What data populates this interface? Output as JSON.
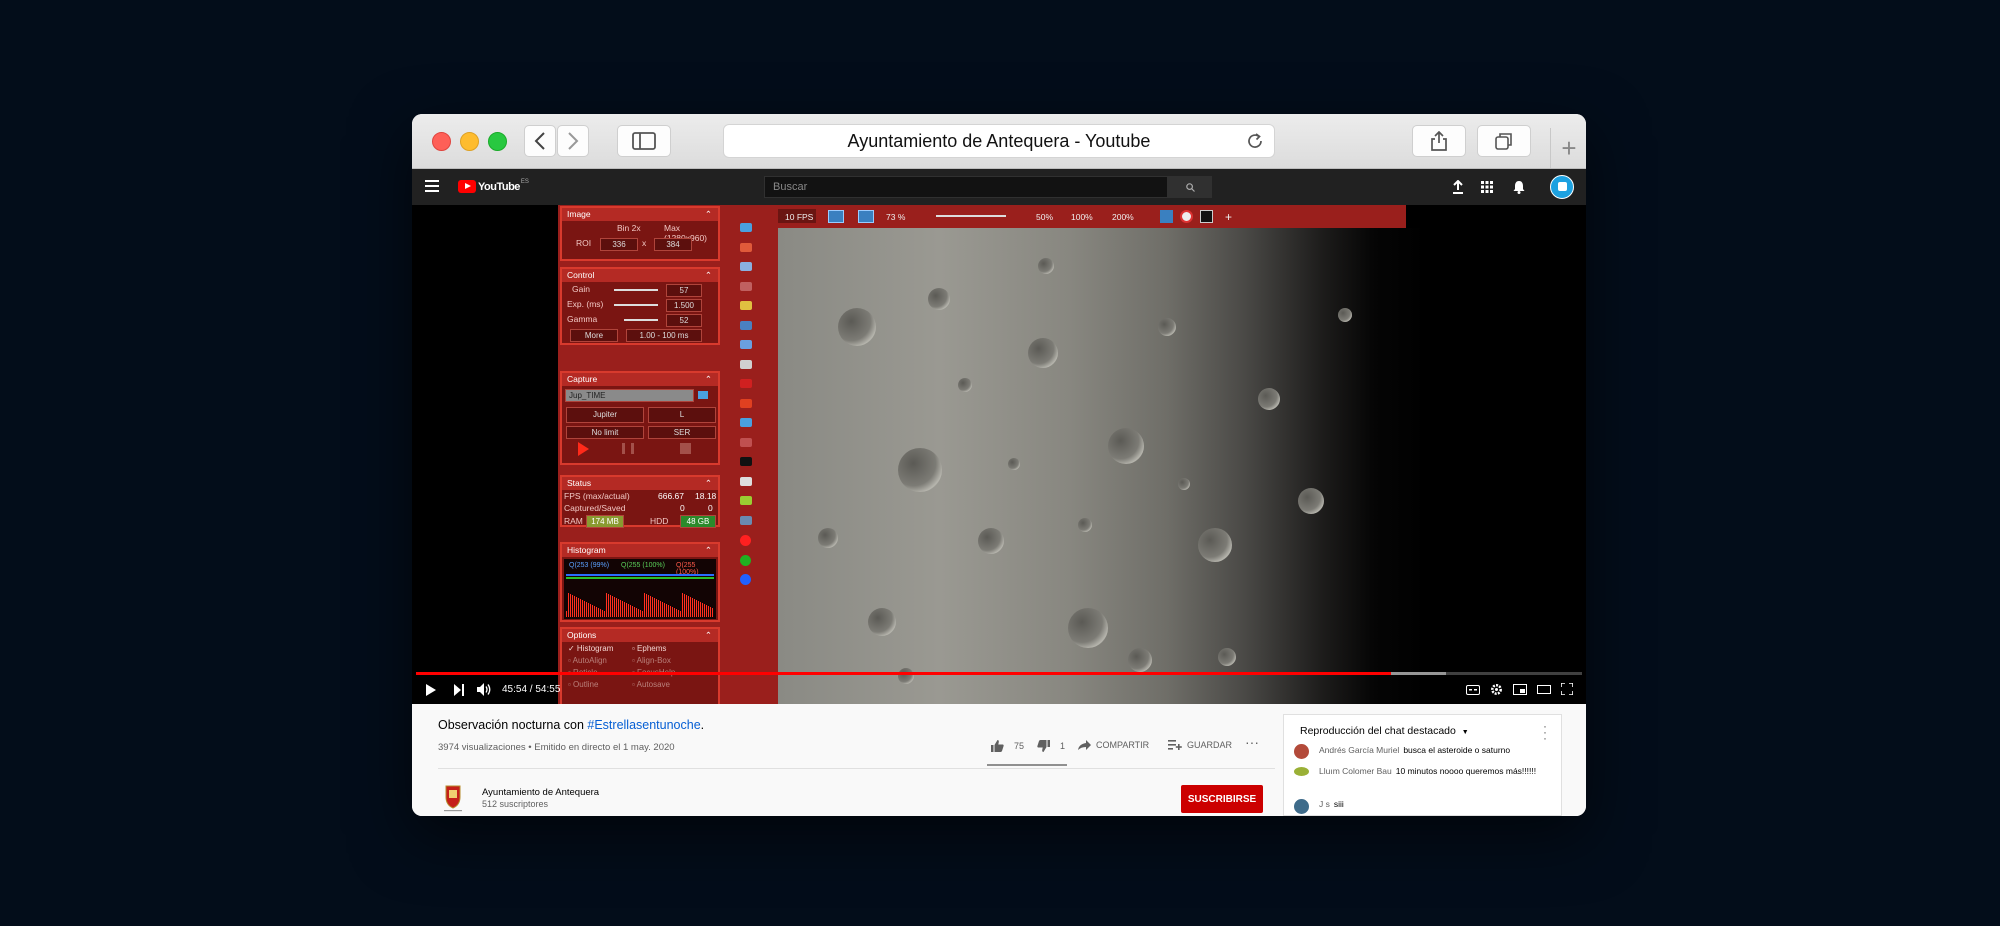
{
  "browser": {
    "url_title": "Ayuntamiento de Antequera - Youtube"
  },
  "youtube": {
    "logo": "YouTube",
    "region": "ES",
    "search_placeholder": "Buscar"
  },
  "app": {
    "image_panel": {
      "title": "Image",
      "bin": "Bin 2x",
      "max": "Max (1280x960)",
      "roi_label": "ROI",
      "roi_w": "336",
      "roi_x": "x",
      "roi_h": "384"
    },
    "control_panel": {
      "title": "Control",
      "gain_label": "Gain",
      "gain_value": "57",
      "exp_label": "Exp. (ms)",
      "exp_value": "1.500",
      "gamma_label": "Gamma",
      "gamma_value": "52",
      "more": "More",
      "range": "1.00 - 100 ms"
    },
    "capture_panel": {
      "title": "Capture",
      "filename": "Jup_TIME",
      "target": "Jupiter",
      "filter": "L",
      "limit": "No limit",
      "format": "SER"
    },
    "status_panel": {
      "title": "Status",
      "fps_label": "FPS (max/actual)",
      "fps_max": "666.67",
      "fps_actual": "18.18",
      "captured_label": "Captured/Saved",
      "captured": "0",
      "saved": "0",
      "ram_label": "RAM",
      "ram_value": "174 MB",
      "hdd_label": "HDD",
      "hdd_value": "48 GB"
    },
    "histogram_panel": {
      "title": "Histogram",
      "q1": "Q(253 (99%)",
      "q2": "Q(255 (100%)",
      "q3": "Q(255 (100%)"
    },
    "options_panel": {
      "title": "Options",
      "items": [
        "Histogram",
        "Ephems",
        "AutoAlign",
        "Align-Box",
        "Reticle",
        "FocusHelp",
        "Outline",
        "Autosave"
      ]
    },
    "topbar": {
      "fps": "10 FPS",
      "zoom": "73 %",
      "z50": "50%",
      "z100": "100%",
      "z200": "200%"
    }
  },
  "player": {
    "time": "45:54 / 54:55",
    "progress": 0.836
  },
  "video": {
    "title_prefix": "Observación nocturna con ",
    "hashtag": "#Estrellasentunoche",
    "title_suffix": ".",
    "meta": "3974 visualizaciones • Emitido en directo el 1 may. 2020",
    "likes": "75",
    "dislikes": "1",
    "share": "COMPARTIR",
    "save": "GUARDAR"
  },
  "channel": {
    "name": "Ayuntamiento de Antequera",
    "subs": "512 suscriptores",
    "subscribe": "SUSCRIBIRSE"
  },
  "chat": {
    "header": "Reproducción del chat destacado",
    "messages": [
      {
        "author": "Andrés García Muriel",
        "text": "busca el asteroide o saturno"
      },
      {
        "author": "Lluım Colomer Bau",
        "text": "10 minutos noooo queremos más!!!!!!"
      },
      {
        "author": "J s",
        "text": "siii"
      }
    ]
  },
  "colors": {
    "app_red": "#9a1f1c",
    "yt_red": "#ff0000",
    "subscribe": "#cc0000",
    "link": "#065fd4"
  }
}
